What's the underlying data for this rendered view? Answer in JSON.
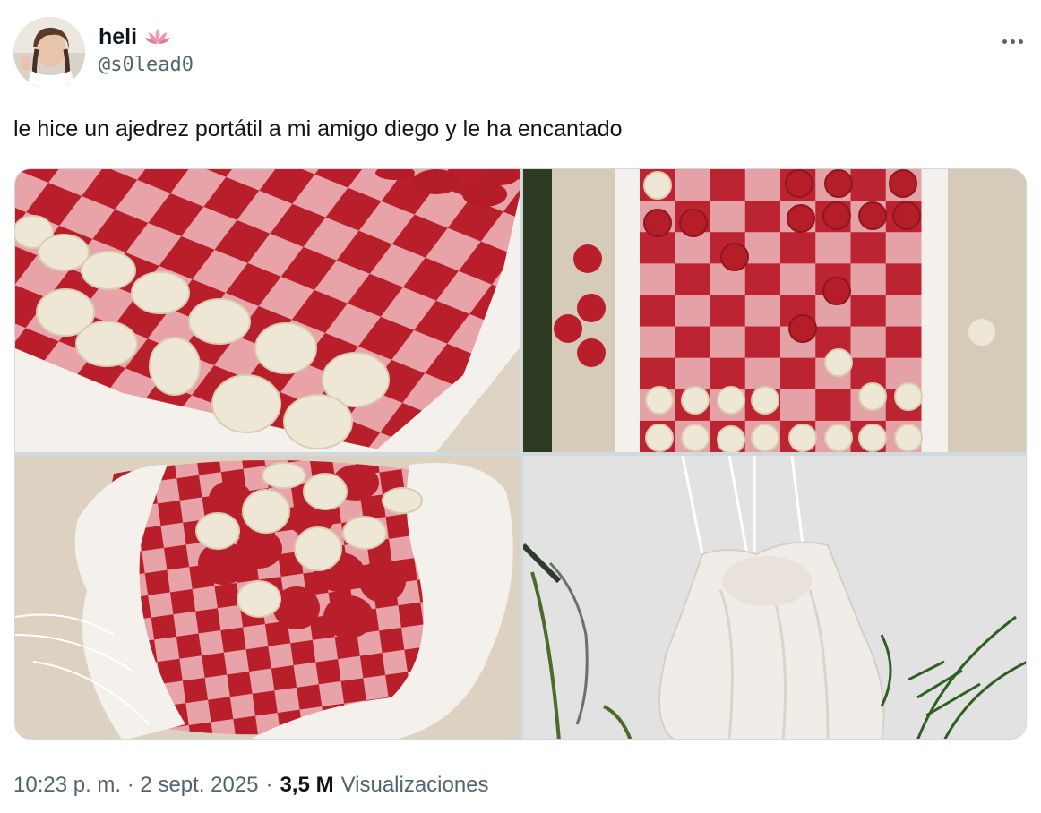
{
  "user": {
    "display_name": "heli",
    "handle": "@s0lead0",
    "badge_icon": "lotus-icon",
    "avatar_alt": "avatar"
  },
  "tweet": {
    "text": "le hice un ajedrez portátil a mi amigo diego y le ha encantado"
  },
  "media": {
    "images": [
      {
        "name": "photo-board-closeup"
      },
      {
        "name": "photo-board-overhead"
      },
      {
        "name": "photo-bag-open"
      },
      {
        "name": "photo-bag-closed"
      }
    ]
  },
  "meta": {
    "time": "10:23 p. m.",
    "separator": "·",
    "date": "2 sept. 2025",
    "views_count": "3,5 M",
    "views_label": "Visualizaciones"
  },
  "colors": {
    "red": "#c0242e",
    "pink": "#e7a3a8",
    "cream": "#efe9da",
    "wood": "#d8cdbb",
    "muted_text": "#536471",
    "text": "#0f1419"
  }
}
